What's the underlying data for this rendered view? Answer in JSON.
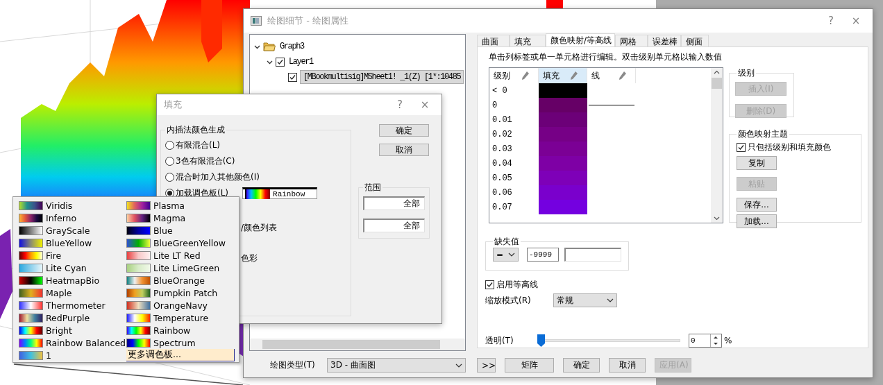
{
  "main_dialog": {
    "title": "绘图细节 - 绘图属性",
    "help": "?",
    "close": "×",
    "tree": [
      {
        "label": "Graph3",
        "kind": "folder",
        "expanded": true,
        "children": [
          {
            "label": "Layer1",
            "kind": "check",
            "checked": true,
            "expanded": true,
            "children": [
              {
                "label": "[MBookmultisig]MSheet1! _1(Z) [1*:10485",
                "kind": "check",
                "checked": true,
                "selected": true
              }
            ]
          }
        ]
      }
    ],
    "tabs": [
      {
        "label": "曲面",
        "selected": false
      },
      {
        "label": "填充",
        "selected": false
      },
      {
        "label": "颜色映射/等高线",
        "selected": true
      },
      {
        "label": "网格",
        "selected": false
      },
      {
        "label": "误差棒",
        "selected": false
      },
      {
        "label": "侧面",
        "selected": false
      }
    ],
    "hint": "单击列标签或单一单元格进行编辑。双击级别单元格以输入数值",
    "level_table": {
      "columns": [
        {
          "label": "级别",
          "selected": false
        },
        {
          "label": "填充",
          "selected": true
        },
        {
          "label": "线",
          "selected": false
        }
      ],
      "rows": [
        {
          "level": "< 0",
          "color": "#000000",
          "line": false
        },
        {
          "level": "0",
          "color": "#660066",
          "line": true
        },
        {
          "level": "0.01",
          "color": "#6c0078",
          "line": false
        },
        {
          "level": "0.02",
          "color": "#760086",
          "line": false
        },
        {
          "level": "0.03",
          "color": "#7b0095",
          "line": false
        },
        {
          "level": "0.04",
          "color": "#7e00a5",
          "line": false
        },
        {
          "level": "0.05",
          "color": "#7e00b8",
          "line": false
        },
        {
          "level": "0.06",
          "color": "#7a00cc",
          "line": false
        },
        {
          "level": "0.07",
          "color": "#7400e0",
          "line": false
        }
      ]
    },
    "levels_group": {
      "title": "级别",
      "buttons": [
        {
          "label": "插入(I)",
          "disabled": true
        },
        {
          "label": "删除(D)",
          "disabled": true
        }
      ]
    },
    "theme_group": {
      "title": "颜色映射主题",
      "checkbox": {
        "label": "只包括级别和填充颜色",
        "checked": true
      },
      "buttons": [
        {
          "label": "复制",
          "disabled": false
        },
        {
          "label": "粘贴",
          "disabled": true
        },
        {
          "label": "保存...",
          "disabled": false
        },
        {
          "label": "加载...",
          "disabled": false
        }
      ]
    },
    "missing_group": {
      "title": "缺失值",
      "operator": "=",
      "value": "-9999"
    },
    "contour_checkbox": {
      "label": "启用等高线",
      "checked": true
    },
    "scale_mode": {
      "label": "缩放模式(R)",
      "value": "常规"
    },
    "transparency": {
      "label": "透明(T)",
      "level": 0,
      "value": "0",
      "unit": "%"
    },
    "plot_type": {
      "label": "绘图类型(T)",
      "value": "3D - 曲面图"
    },
    "buttons": [
      {
        "label": ">>",
        "disabled": false
      },
      {
        "label": "矩阵",
        "disabled": false
      },
      {
        "label": "确定",
        "disabled": false
      },
      {
        "label": "取消",
        "disabled": false
      },
      {
        "label": "应用(A)",
        "disabled": true
      }
    ]
  },
  "fill_dialog": {
    "title": "填充",
    "help": "?",
    "close": "×",
    "group_title": "内插法颜色生成",
    "options": [
      {
        "label": "有限混合(L)",
        "selected": false
      },
      {
        "label": "3色有限混合(C)",
        "selected": false
      },
      {
        "label": "混合时加入其他颜色(I)",
        "selected": false
      },
      {
        "label": "加载调色板(L)",
        "selected": true
      }
    ],
    "palette": {
      "name": "Rainbow"
    },
    "partial_texts": [
      "/颜色列表",
      "色彩"
    ],
    "buttons": [
      "确定",
      "取消"
    ],
    "range": {
      "title": "范围",
      "fields": [
        "全部",
        "全部"
      ]
    }
  },
  "palette_menu": {
    "palettes": [
      {
        "name": "Viridis"
      },
      {
        "name": "Inferno"
      },
      {
        "name": "GrayScale"
      },
      {
        "name": "BlueYellow"
      },
      {
        "name": "Fire"
      },
      {
        "name": "Lite Cyan"
      },
      {
        "name": "HeatmapBio"
      },
      {
        "name": "Maple"
      },
      {
        "name": "Thermometer"
      },
      {
        "name": "RedPurple"
      },
      {
        "name": "Bright"
      },
      {
        "name": "Rainbow Balanced"
      },
      {
        "name": "1"
      },
      {
        "name": "Plasma"
      },
      {
        "name": "Magma"
      },
      {
        "name": "Blue"
      },
      {
        "name": "BlueGreenYellow"
      },
      {
        "name": "Lite LT Red"
      },
      {
        "name": "Lite LimeGreen"
      },
      {
        "name": "BlueOrange"
      },
      {
        "name": "Pumpkin Patch"
      },
      {
        "name": "OrangeNavy"
      },
      {
        "name": "Temperature"
      },
      {
        "name": "Rainbow"
      },
      {
        "name": "Spectrum"
      }
    ],
    "more_item": {
      "label": "更多调色板...",
      "selected": true
    }
  }
}
